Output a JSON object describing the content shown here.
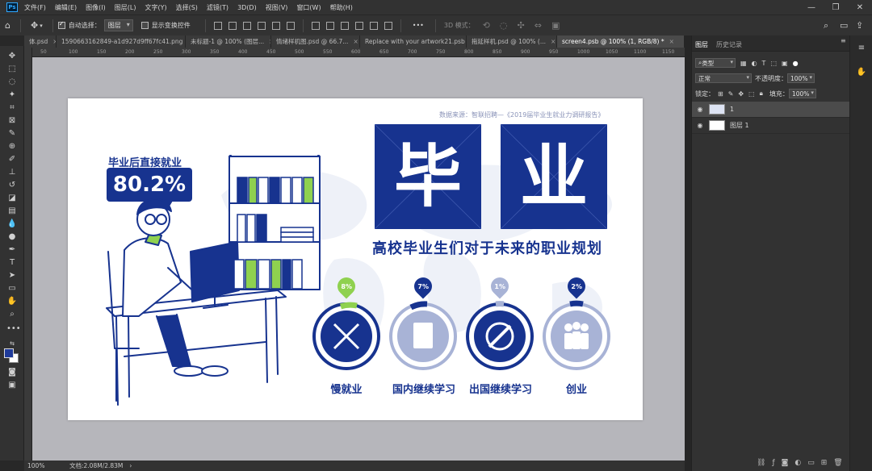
{
  "app": {
    "logo": "Ps",
    "menu": [
      "文件(F)",
      "编辑(E)",
      "图像(I)",
      "图层(L)",
      "文字(Y)",
      "选择(S)",
      "滤镜(T)",
      "3D(D)",
      "视图(V)",
      "窗口(W)",
      "帮助(H)"
    ],
    "window_controls": [
      "—",
      "❐",
      "✕"
    ]
  },
  "options": {
    "auto_select_label": "自动选择：",
    "auto_select_value": "图层",
    "show_transform_label": "显示变换控件",
    "more": "•••",
    "mode_3d_label": "3D 模式："
  },
  "tabs": [
    {
      "label": "体.psd",
      "active": false
    },
    {
      "label": "1590663162849-a1d927d9ff67fc41.png",
      "active": false
    },
    {
      "label": "未标题-1 @ 100% (图层...",
      "active": false
    },
    {
      "label": "情绪样机图.psd @ 66.7...",
      "active": false
    },
    {
      "label": "Replace with your artwork21.psb",
      "active": false
    },
    {
      "label": "拖延样机.psd @ 100% (...",
      "active": false
    },
    {
      "label": "screen4.psb @ 100% (1, RGB/8) *",
      "active": true
    }
  ],
  "ruler_ticks": [
    "50",
    "100",
    "150",
    "200",
    "250",
    "300",
    "350",
    "400",
    "450",
    "500",
    "550",
    "600",
    "650",
    "700",
    "750",
    "800",
    "850",
    "900",
    "950",
    "1000",
    "1050",
    "1100",
    "1150"
  ],
  "status": {
    "zoom": "100%",
    "doc": "文档:2.08M/2.83M",
    "arrow": "›"
  },
  "panel": {
    "tab_layers": "图层",
    "tab_history": "历史记录",
    "filter_kind": "类型",
    "blend_mode": "正常",
    "opacity_label": "不透明度：",
    "opacity_value": "100%",
    "lock_label": "锁定：",
    "fill_label": "填充：",
    "fill_value": "100%",
    "layers": [
      {
        "name": "1",
        "selected": true
      },
      {
        "name": "图层 1",
        "selected": false
      }
    ]
  },
  "artwork": {
    "source": "数据来源：智联招聘—《2019届毕业生就业力调研报告》",
    "title_char_1": "毕",
    "title_char_2": "业",
    "subtitle": "高校毕业生们对于未来的职业规划",
    "badge_label": "毕业后直接就业",
    "badge_value": "80.2%",
    "categories": [
      {
        "label": "慢就业",
        "value": "8%",
        "color": "#8fd14f",
        "ring": "#17338f",
        "icon": "pencil-ruler-icon"
      },
      {
        "label": "国内继续学习",
        "value": "7%",
        "color": "#17338f",
        "ring": "#a8b3d6",
        "icon": "book-icon"
      },
      {
        "label": "出国继续学习",
        "value": "1%",
        "color": "#a8b3d6",
        "ring": "#17338f",
        "icon": "plane-icon"
      },
      {
        "label": "创业",
        "value": "2%",
        "color": "#17338f",
        "ring": "#a8b3d6",
        "icon": "team-icon"
      }
    ]
  },
  "colors": {
    "navy": "#17338f",
    "green": "#8fd14f",
    "lightblue": "#a8b3d6"
  }
}
